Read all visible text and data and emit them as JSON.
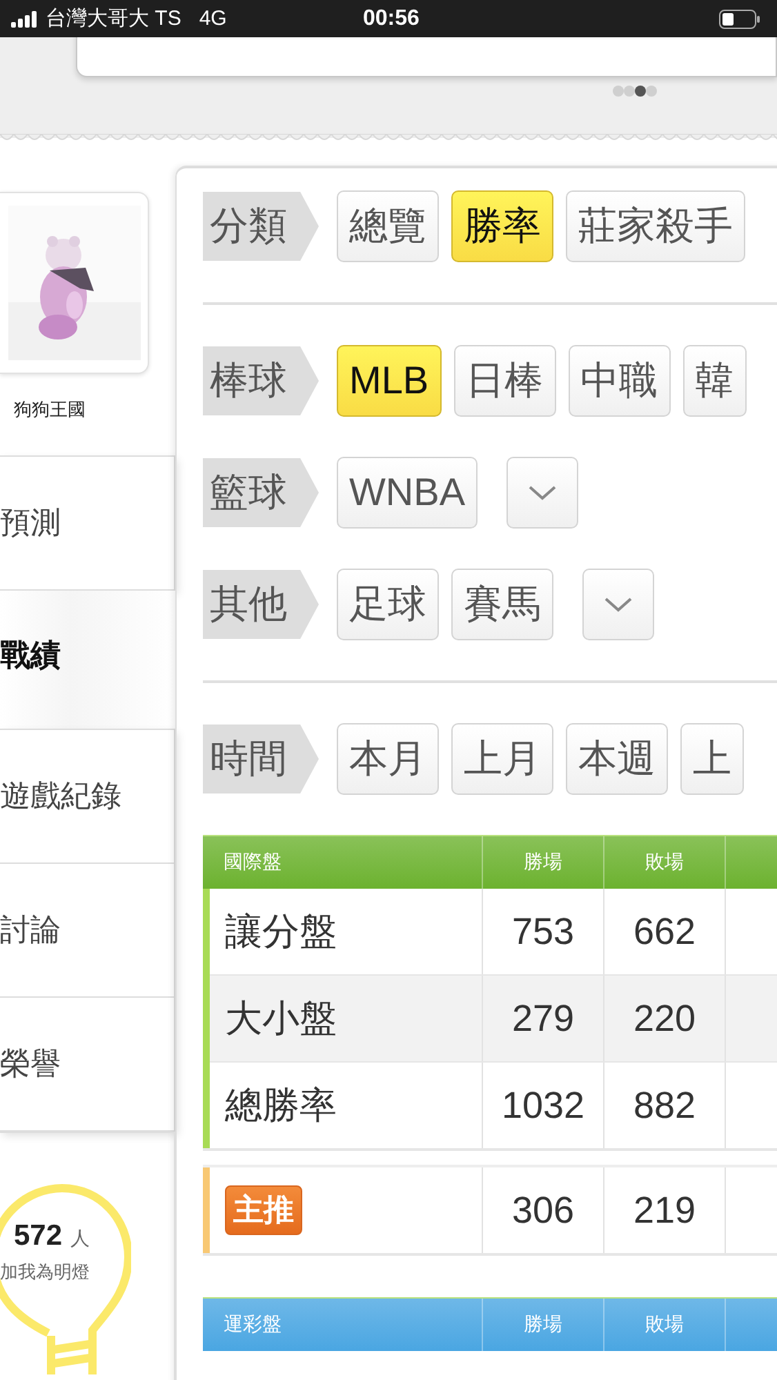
{
  "status_bar": {
    "carrier": "台灣大哥大 TS",
    "network": "4G",
    "time": "00:56"
  },
  "banner": {
    "pages": [
      {
        "selected": false
      },
      {
        "selected": false
      },
      {
        "selected": true
      },
      {
        "selected": false
      }
    ]
  },
  "profile": {
    "name": "狗狗王國"
  },
  "sidebar": {
    "groups": [
      {
        "items": [
          {
            "label": "預測",
            "selected": false
          }
        ]
      },
      {
        "items": [
          {
            "label": "戰績",
            "selected": true
          }
        ]
      },
      {
        "items": [
          {
            "label": "遊戲紀錄",
            "selected": false
          },
          {
            "label": "討論",
            "selected": false
          },
          {
            "label": "榮譽",
            "selected": false
          }
        ]
      }
    ]
  },
  "followers": {
    "count": "572",
    "unit": "人",
    "caption": "加我為明燈"
  },
  "filters": [
    {
      "label": "分類",
      "options": [
        {
          "text": "總覽",
          "selected": false
        },
        {
          "text": "勝率",
          "selected": true
        },
        {
          "text": "莊家殺手",
          "selected": false
        }
      ],
      "divider_after": true
    },
    {
      "label": "棒球",
      "options": [
        {
          "text": "MLB",
          "selected": true
        },
        {
          "text": "日棒",
          "selected": false
        },
        {
          "text": "中職",
          "selected": false
        },
        {
          "text": "韓",
          "selected": false
        }
      ]
    },
    {
      "label": "籃球",
      "options": [
        {
          "text": "WNBA",
          "selected": false
        }
      ],
      "dropdown": true
    },
    {
      "label": "其他",
      "options": [
        {
          "text": "足球",
          "selected": false
        },
        {
          "text": "賽馬",
          "selected": false
        }
      ],
      "dropdown": true,
      "divider_after": true
    },
    {
      "label": "時間",
      "options": [
        {
          "text": "本月",
          "selected": false
        },
        {
          "text": "上月",
          "selected": false
        },
        {
          "text": "本週",
          "selected": false
        },
        {
          "text": "上",
          "selected": false
        }
      ]
    }
  ],
  "tables": [
    {
      "color": "#6cb22f",
      "columns": [
        "國際盤",
        "勝場",
        "敗場"
      ],
      "groups": [
        {
          "color": "#a8db55",
          "rows": [
            {
              "kind": "text",
              "label": "讓分盤",
              "wins": "753",
              "losses": "662"
            },
            {
              "kind": "text",
              "label": "大小盤",
              "wins": "279",
              "losses": "220"
            },
            {
              "kind": "text",
              "label": "總勝率",
              "wins": "1032",
              "losses": "882"
            }
          ]
        },
        {
          "color": "#f8c873",
          "rows": [
            {
              "kind": "badge",
              "label": "主推",
              "wins": "306",
              "losses": "219"
            }
          ]
        }
      ]
    },
    {
      "color": "#4aa6e2",
      "columns": [
        "運彩盤",
        "勝場",
        "敗場"
      ]
    }
  ]
}
